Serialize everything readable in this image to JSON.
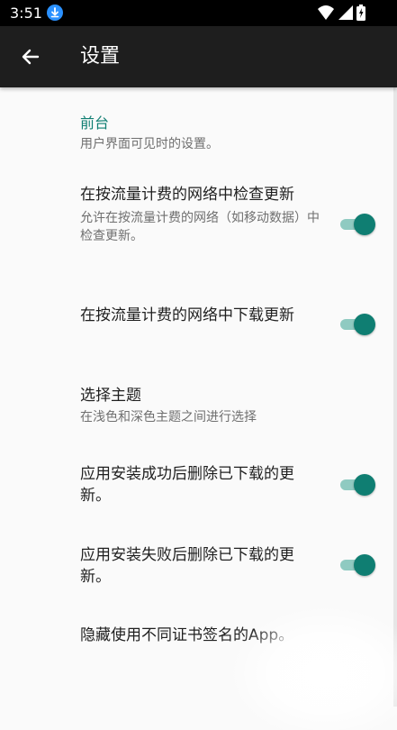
{
  "status_bar": {
    "time": "3:51",
    "icons": [
      "download-icon",
      "wifi-icon",
      "signal-icon",
      "battery-icon"
    ]
  },
  "app_bar": {
    "title": "设置",
    "back_icon": "arrow-left-icon"
  },
  "section": {
    "title": "前台",
    "subtitle": "用户界面可见时的设置。"
  },
  "prefs": [
    {
      "title": "在按流量计费的网络中检查更新",
      "subtitle": "允许在按流量计费的网络（如移动数据）中检查更新。",
      "switch_on": true
    },
    {
      "title": "在按流量计费的网络中下载更新",
      "subtitle": "",
      "switch_on": true
    },
    {
      "title": "选择主题",
      "subtitle": "在浅色和深色主题之间进行选择"
    },
    {
      "title": "应用安装成功后删除已下载的更新。",
      "subtitle": "",
      "switch_on": true
    },
    {
      "title": "应用安装失败后删除已下载的更新。",
      "subtitle": "",
      "switch_on": true
    },
    {
      "title": "隐藏使用不同证书签名的App。",
      "subtitle": ""
    }
  ],
  "colors": {
    "accent": "#0f7e72",
    "accent_track": "#8fcac1",
    "app_bar": "#1e1e1e",
    "background": "#fafafa"
  }
}
